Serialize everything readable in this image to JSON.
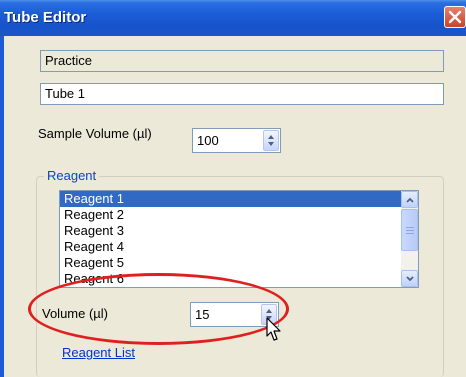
{
  "window": {
    "title": "Tube Editor"
  },
  "fields": {
    "practice": "Practice",
    "tube_name": "Tube 1"
  },
  "sample_volume": {
    "label": "Sample Volume (µl)",
    "value": "100"
  },
  "reagent_group": {
    "label": "Reagent",
    "items": [
      {
        "label": "Reagent 1",
        "selected": true
      },
      {
        "label": "Reagent 2"
      },
      {
        "label": "Reagent 3"
      },
      {
        "label": "Reagent 4"
      },
      {
        "label": "Reagent 5"
      },
      {
        "label": "Reagent 6"
      }
    ],
    "volume_label": "Volume (µl)",
    "volume_value": "15",
    "link": "Reagent List"
  },
  "annotation": {
    "color": "#e0201e"
  }
}
